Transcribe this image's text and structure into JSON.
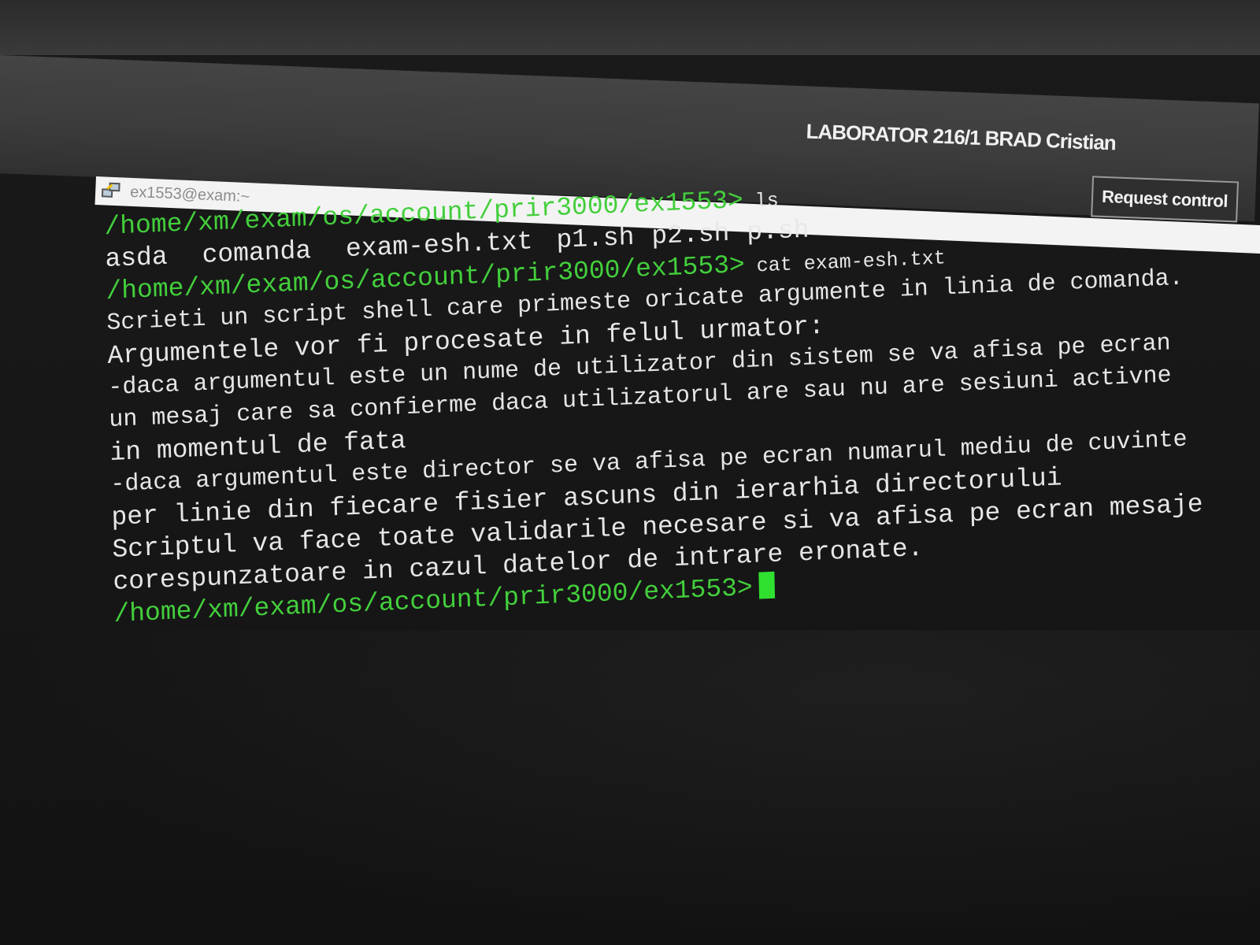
{
  "viewer": {
    "session_title": "LABORATOR 216/1 BRAD Cristian",
    "request_control_label": "Request control"
  },
  "window": {
    "title": "ex1553@exam:~",
    "icon": "putty-icon"
  },
  "terminal": {
    "prompt": "/home/xm/exam/os/account/prir3000/ex1553>",
    "commands": {
      "ls": " ls",
      "cat": " cat exam-esh.txt"
    },
    "ls_output": {
      "directory": "asda",
      "files": [
        "comanda",
        "exam-esh.txt",
        "p1.sh",
        "p2.sh",
        "p.sh"
      ]
    },
    "file_lines": [
      "Scrieti un script shell care primeste oricate argumente in linia de comanda.",
      "Argumentele vor fi procesate in felul urmator:",
      "-daca argumentul este un nume de utilizator din sistem se va afisa pe ecran",
      "un mesaj care sa confierme daca utilizatorul are sau nu are sesiuni activne",
      "in momentul de fata",
      "-daca argumentul este director se va afisa pe ecran numarul mediu de cuvinte",
      "per linie din fiecare fisier ascuns din ierarhia directorului",
      "Scriptul va face toate validarile necesare si va afisa pe ecran mesaje",
      "corespunzatoare in cazul datelor de intrare eronate."
    ],
    "colors": {
      "prompt": "#43cf3c",
      "directory": "#5b7bff",
      "text": "#e6e6e6",
      "cursor": "#30e030"
    }
  }
}
